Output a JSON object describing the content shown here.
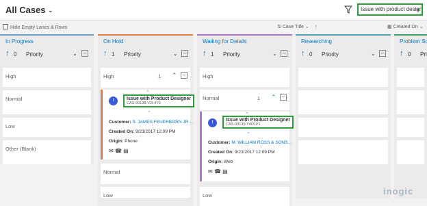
{
  "header": {
    "view_title": "All Cases",
    "search_value": "Issue with product design",
    "clear_glyph": "×"
  },
  "toolbar": {
    "hide_empty_lanes": "Hide Empty Lanes & Rows",
    "sort_field": "Case Title",
    "created_on": "Created On"
  },
  "lanes": [
    {
      "title": "In Progress",
      "count": "0",
      "field": "Priority",
      "color": "#6b9bd1"
    },
    {
      "title": "On Hold",
      "count": "1",
      "field": "Priority",
      "color": "#e07a3d"
    },
    {
      "title": "Waiting for Details",
      "count": "1",
      "field": "Priority",
      "color": "#a37ec5"
    },
    {
      "title": "Researching",
      "count": "0",
      "field": "Priority",
      "color": "#4ea3b5"
    },
    {
      "title": "Problem Solv",
      "count": "0",
      "field": "Priority",
      "color": "#3fa36f"
    }
  ],
  "groups": {
    "high": "High",
    "normal": "Normal",
    "low": "Low",
    "other": "Other (Blank)",
    "high_count": "1",
    "normal_count": "1"
  },
  "cards": [
    {
      "avatar": "I",
      "title": "Issue with Product Designer",
      "case_id": "CAS-00138-V2L4Y2",
      "customer_label": "Customer:",
      "customer": "S. JAMES FEUERBORN JR ...",
      "created_label": "Created On:",
      "created": "9/23/2017 12:09 PM",
      "origin_label": "Origin:",
      "origin": "Phone"
    },
    {
      "avatar": "I",
      "title": "Issue with Product Designer",
      "case_id": "CAS-00139-Y4D1P1",
      "customer_label": "Customer:",
      "customer": "M. WILLIAM ROSS & SONS...",
      "created_label": "Created On:",
      "created": "9/23/2017 12:09 PM",
      "origin_label": "Origin:",
      "origin": "Web"
    }
  ],
  "watermark": "inogic"
}
